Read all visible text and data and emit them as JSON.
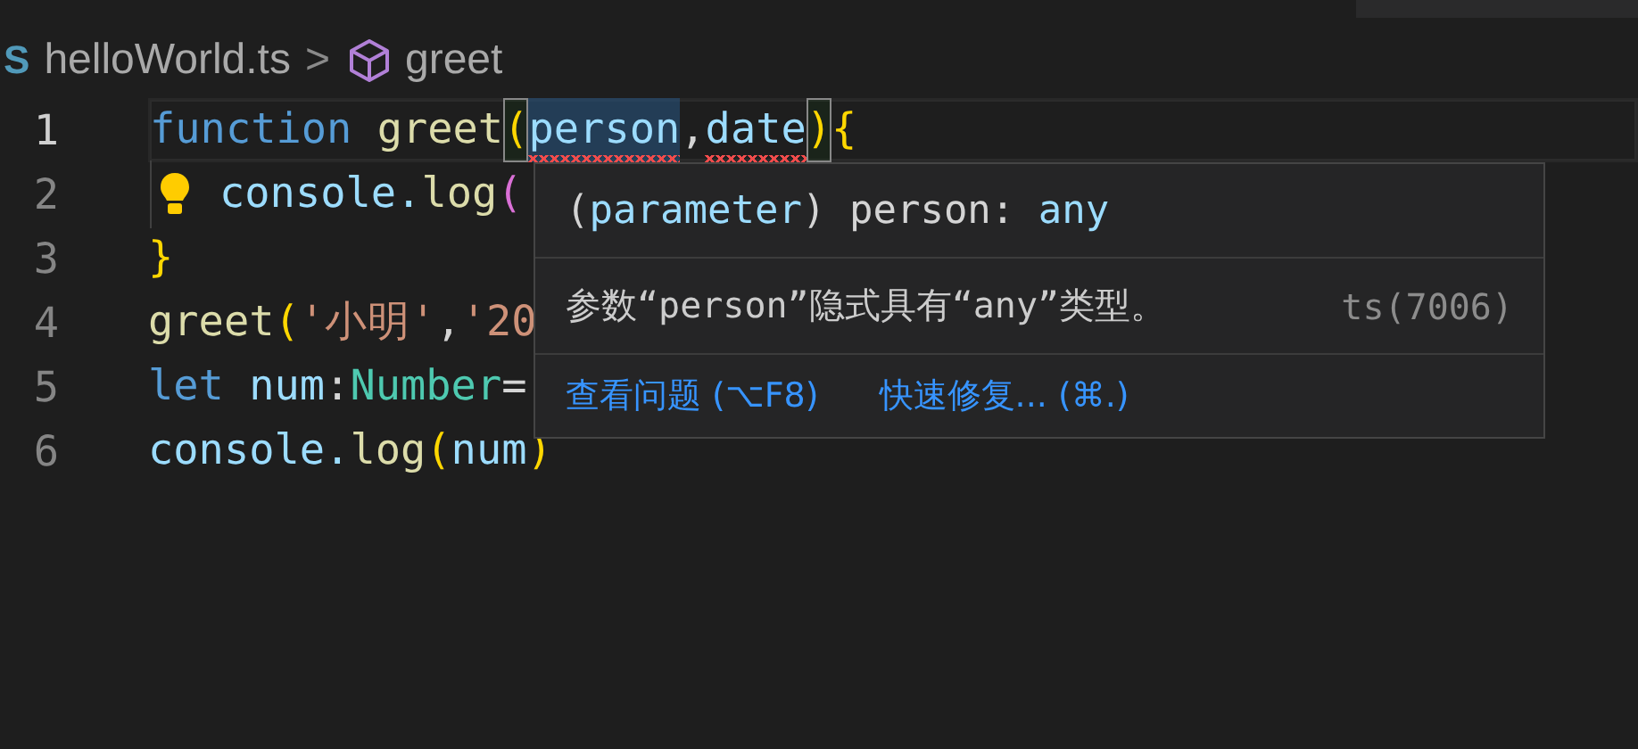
{
  "breadcrumb": {
    "file_badge": "S",
    "file": "helloWorld.ts",
    "separator": ">",
    "symbol": "greet"
  },
  "lines": [
    {
      "number": "1",
      "current": true,
      "lightbulb": false,
      "tokens": [
        {
          "text": "function ",
          "kind": "keyword",
          "squiggle": false,
          "highlight": false
        },
        {
          "text": "greet",
          "kind": "function",
          "squiggle": false,
          "highlight": false
        },
        {
          "text": "(",
          "kind": "bracket-match",
          "squiggle": false,
          "highlight": false
        },
        {
          "text": "person",
          "kind": "param",
          "squiggle": true,
          "highlight": true
        },
        {
          "text": ",",
          "kind": "plain",
          "squiggle": false,
          "highlight": false
        },
        {
          "text": "date",
          "kind": "param",
          "squiggle": true,
          "highlight": false
        },
        {
          "text": ")",
          "kind": "bracket-match",
          "squiggle": false,
          "highlight": false
        },
        {
          "text": "{",
          "kind": "bracket1",
          "squiggle": false,
          "highlight": false
        }
      ]
    },
    {
      "number": "2",
      "current": false,
      "lightbulb": true,
      "tokens": [
        {
          "text": "console.",
          "kind": "param"
        },
        {
          "text": "log",
          "kind": "function"
        },
        {
          "text": "(",
          "kind": "bracket2"
        }
      ]
    },
    {
      "number": "3",
      "current": false,
      "lightbulb": false,
      "tokens": [
        {
          "text": "}",
          "kind": "bracket1"
        }
      ]
    },
    {
      "number": "4",
      "current": false,
      "lightbulb": false,
      "tokens": [
        {
          "text": "greet",
          "kind": "function"
        },
        {
          "text": "(",
          "kind": "bracket1"
        },
        {
          "text": "'小明'",
          "kind": "string"
        },
        {
          "text": ",",
          "kind": "plain"
        },
        {
          "text": "'20",
          "kind": "string"
        }
      ]
    },
    {
      "number": "5",
      "current": false,
      "lightbulb": false,
      "tokens": [
        {
          "text": "let ",
          "kind": "keyword"
        },
        {
          "text": "num",
          "kind": "param"
        },
        {
          "text": ":",
          "kind": "plain"
        },
        {
          "text": "Number",
          "kind": "type"
        },
        {
          "text": "=",
          "kind": "plain"
        }
      ]
    },
    {
      "number": "6",
      "current": false,
      "lightbulb": false,
      "tokens": [
        {
          "text": "console.",
          "kind": "param"
        },
        {
          "text": "log",
          "kind": "function"
        },
        {
          "text": "(",
          "kind": "bracket1"
        },
        {
          "text": "num",
          "kind": "param"
        },
        {
          "text": ")",
          "kind": "bracket1"
        }
      ]
    }
  ],
  "hover": {
    "signature": [
      {
        "text": "(",
        "kind": "plain"
      },
      {
        "text": "parameter",
        "kind": "param"
      },
      {
        "text": ") person: ",
        "kind": "plain"
      },
      {
        "text": "any",
        "kind": "param"
      }
    ],
    "message": "参数“person”隐式具有“any”类型。",
    "code": "ts(7006)",
    "actions": [
      "查看问题 (⌥F8)",
      "快速修复... (⌘.)"
    ]
  }
}
